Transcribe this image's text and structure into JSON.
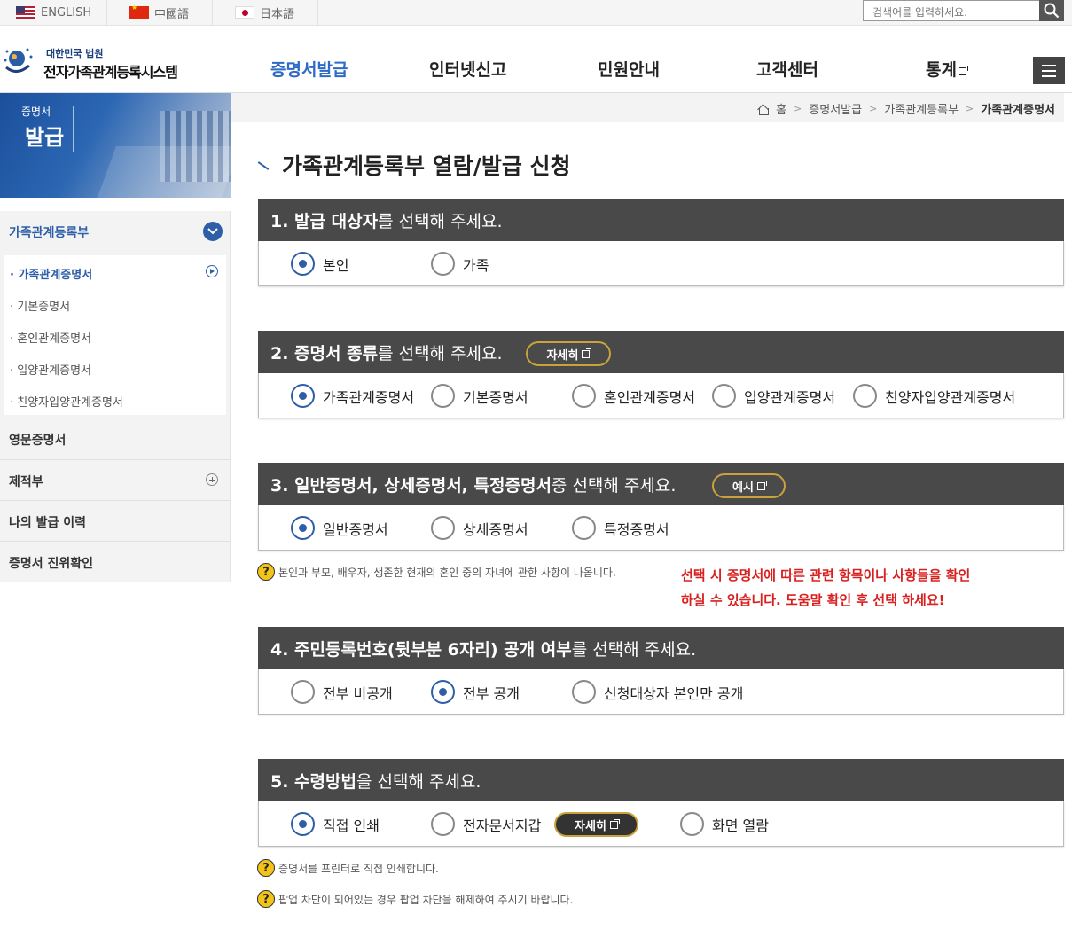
{
  "languages": [
    {
      "label": "ENGLISH",
      "flag": "us-flag"
    },
    {
      "label": "中國語",
      "flag": "cn-flag"
    },
    {
      "label": "日本語",
      "flag": "jp-flag"
    }
  ],
  "search": {
    "placeholder": "검색어를 입력하세요."
  },
  "logo": {
    "small": "대한민국 법원",
    "big": "전자가족관계등록시스템"
  },
  "gnb": [
    "증명서발급",
    "인터넷신고",
    "민원안내",
    "고객센터",
    "통계"
  ],
  "banner": {
    "line1": "증명서",
    "line2": "발급"
  },
  "lnb": {
    "top": "가족관계등록부",
    "sub_items": [
      "가족관계증명서",
      "기본증명서",
      "혼인관계증명서",
      "입양관계증명서",
      "친양자입양관계증명서"
    ],
    "items": [
      "영문증명서",
      "제적부",
      "나의 발급 이력",
      "증명서 진위확인"
    ]
  },
  "breadcrumb": {
    "home": "홈",
    "level1": "증명서발급",
    "level2": "가족관계등록부",
    "current": "가족관계증명서"
  },
  "page_title": "가족관계등록부 열람/발급 신청",
  "sections": {
    "s1": {
      "bold": "1. 발급 대상자",
      "rest": "를 선택해 주세요.",
      "options": [
        "본인",
        "가족"
      ],
      "selected": "본인"
    },
    "s2": {
      "bold": "2. 증명서 종류",
      "rest": "를 선택해 주세요.",
      "detail_btn": "자세히",
      "options": [
        "가족관계증명서",
        "기본증명서",
        "혼인관계증명서",
        "입양관계증명서",
        "친양자입양관계증명서"
      ],
      "selected": "가족관계증명서"
    },
    "s3": {
      "bold": "3. 일반증명서, 상세증명서, 특정증명서",
      "rest": " 중 선택해 주세요.",
      "example_btn": "예시",
      "options": [
        "일반증명서",
        "상세증명서",
        "특정증명서"
      ],
      "selected": "일반증명서"
    },
    "s4": {
      "bold": "4. 주민등록번호(뒷부분 6자리) 공개 여부",
      "rest": "를 선택해 주세요.",
      "options": [
        "전부 비공개",
        "전부 공개",
        "신청대상자 본인만 공개"
      ],
      "selected": "전부 공개"
    },
    "s5": {
      "bold": "5. 수령방법",
      "rest": "을 선택해 주세요.",
      "detail_btn": "자세히",
      "options": [
        "직접 인쇄",
        "전자문서지갑",
        "화면 열람"
      ],
      "selected": "직접 인쇄"
    }
  },
  "help": {
    "s3_note": "본인과 부모, 배우자, 생존한 현재의 혼인 중의 자녀에 관한 사항이 나옵니다.",
    "warning_line1": "선택 시 증명서에 따른 관련 항목이나 사항들을 확인",
    "warning_line2": "하실 수 있습니다. 도움말 확인 후 선택 하세요!",
    "s5_note1": "증명서를 프린터로 직접 인쇄합니다.",
    "s5_note2": "팝업 차단이 되어있는 경우 팝업 차단을 해제하여 주시기 바랍니다."
  },
  "colors": {
    "accent": "#2e5ea8",
    "section_header": "#494949",
    "warning": "#d92020",
    "help_icon": "#f2c318"
  }
}
